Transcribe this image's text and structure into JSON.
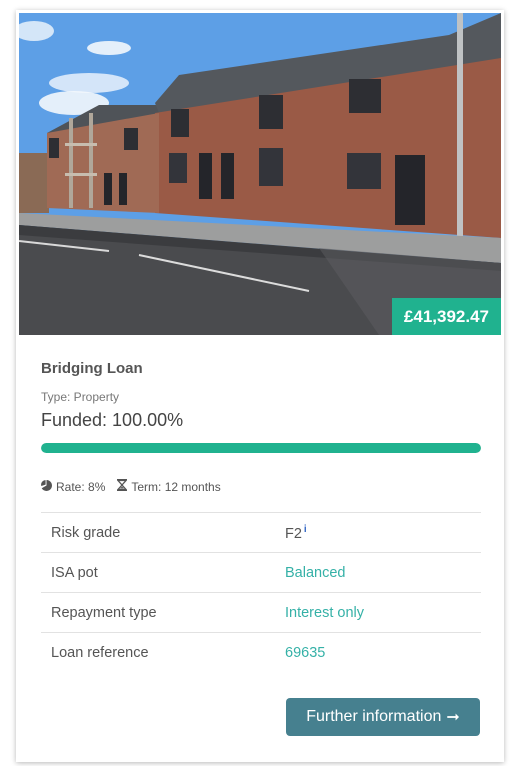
{
  "listing": {
    "amount": "£41,392.47",
    "title": "Bridging Loan",
    "type": "Type: Property",
    "funded": "Funded: 100.00%",
    "funded_fraction": 1.0,
    "rate": "Rate: 8%",
    "term": "Term: 12 months",
    "details": [
      {
        "label": "Risk grade",
        "value": "F2"
      },
      {
        "label": "ISA pot",
        "value": "Balanced"
      },
      {
        "label": "Repayment type",
        "value": "Interest only"
      },
      {
        "label": "Loan reference",
        "value": "69635"
      }
    ],
    "info_marker": "i",
    "button_label": "Further information",
    "button_arrow": "➞"
  },
  "colors": {
    "accent": "#20b28f",
    "link": "#35b1a7",
    "button": "#46808f"
  },
  "icons": {
    "rate": "pie-chart-icon",
    "term": "hourglass-icon",
    "risk_info": "info-icon"
  }
}
